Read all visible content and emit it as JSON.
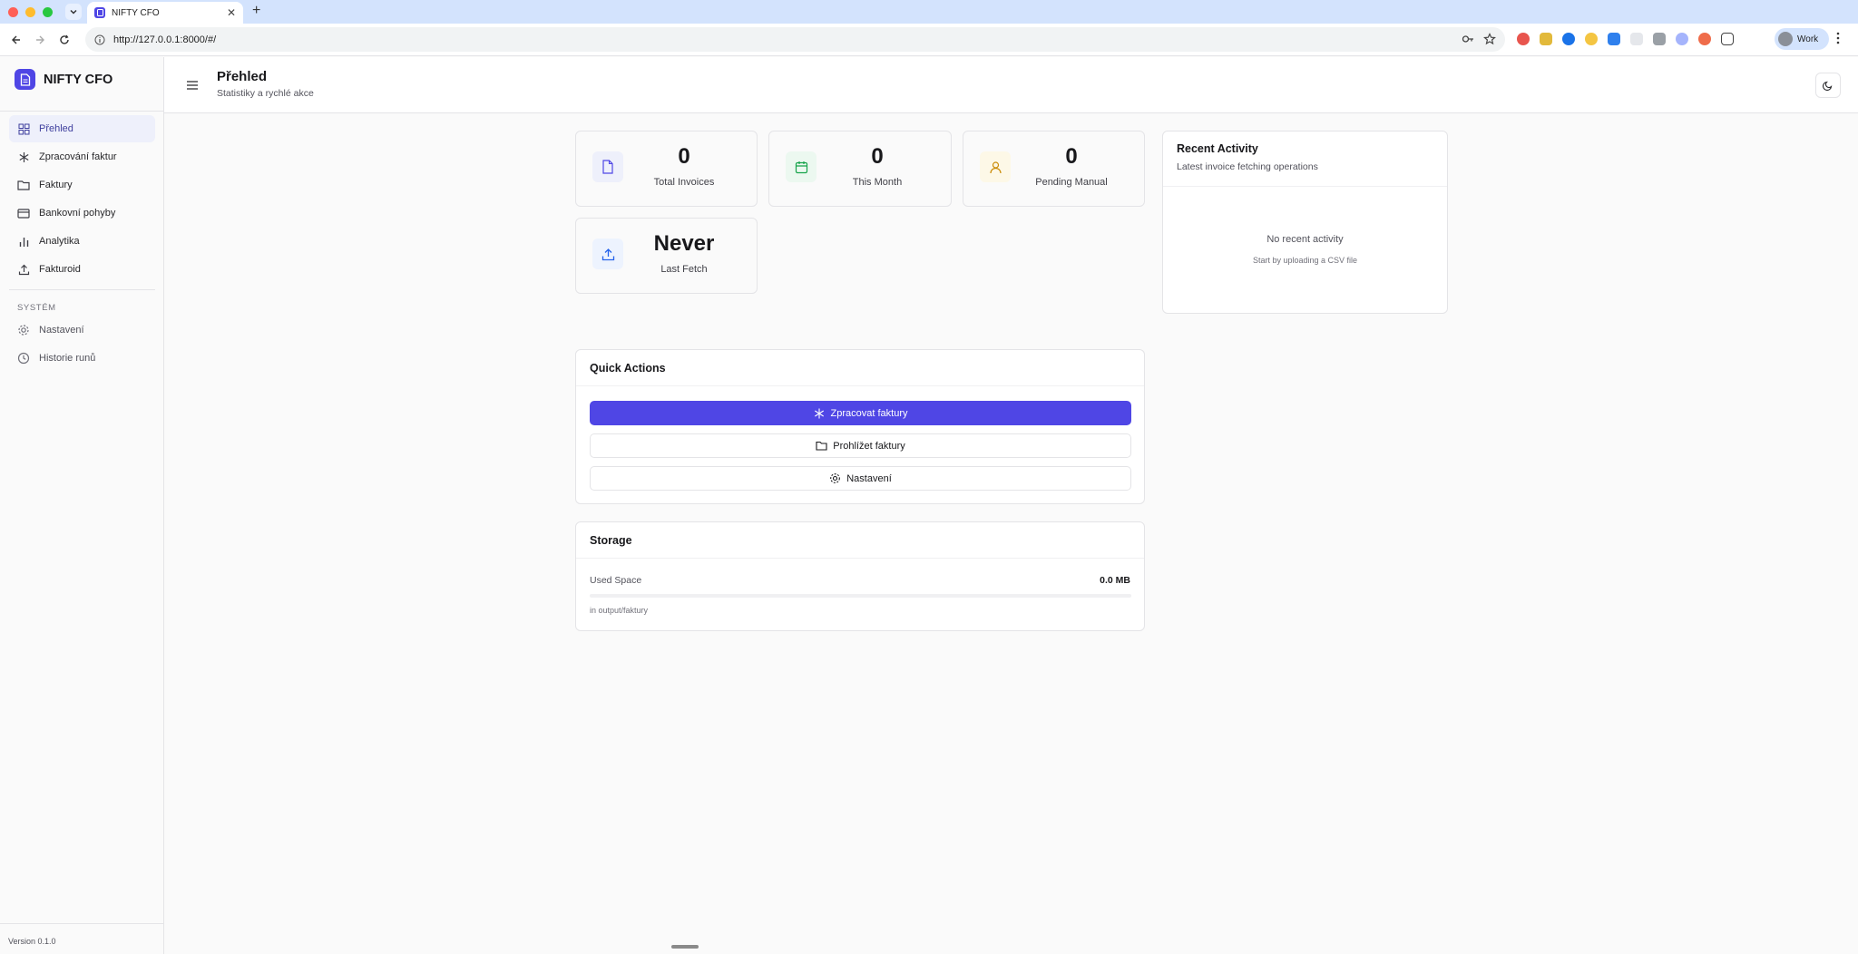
{
  "browser": {
    "tab_title": "NIFTY CFO",
    "url": "http://127.0.0.1:8000/#/",
    "profile_name": "Work"
  },
  "sidebar": {
    "brand": "NIFTY CFO",
    "items": [
      {
        "label": "Přehled",
        "icon": "grid-icon"
      },
      {
        "label": "Zpracování faktur",
        "icon": "sparkle-icon"
      },
      {
        "label": "Faktury",
        "icon": "folder-icon"
      },
      {
        "label": "Bankovní pohyby",
        "icon": "card-icon"
      },
      {
        "label": "Analytika",
        "icon": "bar-chart-icon"
      },
      {
        "label": "Fakturoid",
        "icon": "upload-icon"
      }
    ],
    "system_label": "SYSTÉM",
    "system_items": [
      {
        "label": "Nastavení",
        "icon": "gear-icon"
      },
      {
        "label": "Historie runů",
        "icon": "clock-icon"
      }
    ],
    "version": "Version 0.1.0"
  },
  "header": {
    "title": "Přehled",
    "subtitle": "Statistiky a rychlé akce"
  },
  "stats": [
    {
      "value": "0",
      "label": "Total Invoices",
      "icon": "file-icon",
      "color": "#4f46e5"
    },
    {
      "value": "0",
      "label": "This Month",
      "icon": "calendar-icon",
      "color": "#16a34a"
    },
    {
      "value": "0",
      "label": "Pending Manual",
      "icon": "user-icon",
      "color": "#ca8a04"
    },
    {
      "value": "Never",
      "label": "Last Fetch",
      "icon": "upload-icon",
      "color": "#2563eb"
    }
  ],
  "recent_activity": {
    "title": "Recent Activity",
    "subtitle": "Latest invoice fetching operations",
    "empty_title": "No recent activity",
    "empty_hint": "Start by uploading a CSV file"
  },
  "quick_actions": {
    "title": "Quick Actions",
    "process_label": "Zpracovat faktury",
    "browse_label": "Prohlížet faktury",
    "settings_label": "Nastavení"
  },
  "storage": {
    "title": "Storage",
    "used_label": "Used Space",
    "used_value": "0.0 MB",
    "used_fraction": 0,
    "location": "in output/faktury"
  },
  "colors": {
    "accent": "#4f46e5"
  }
}
